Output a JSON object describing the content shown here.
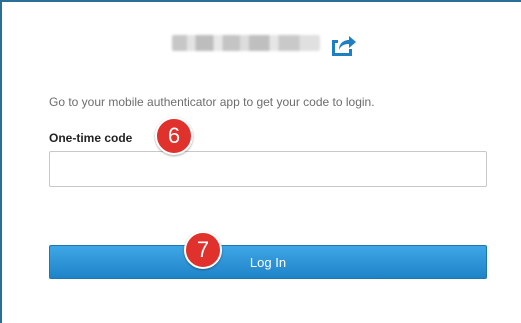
{
  "header": {
    "share_icon": "share-export-icon",
    "accent_color": "#1e7fc2"
  },
  "instruction_text": "Go to your mobile authenticator app to get your code to login.",
  "otp": {
    "label": "One-time code",
    "value": "",
    "placeholder": ""
  },
  "login_button_label": "Log In",
  "annotations": {
    "step_6": "6",
    "step_7": "7",
    "badge_color": "#e0312c"
  }
}
